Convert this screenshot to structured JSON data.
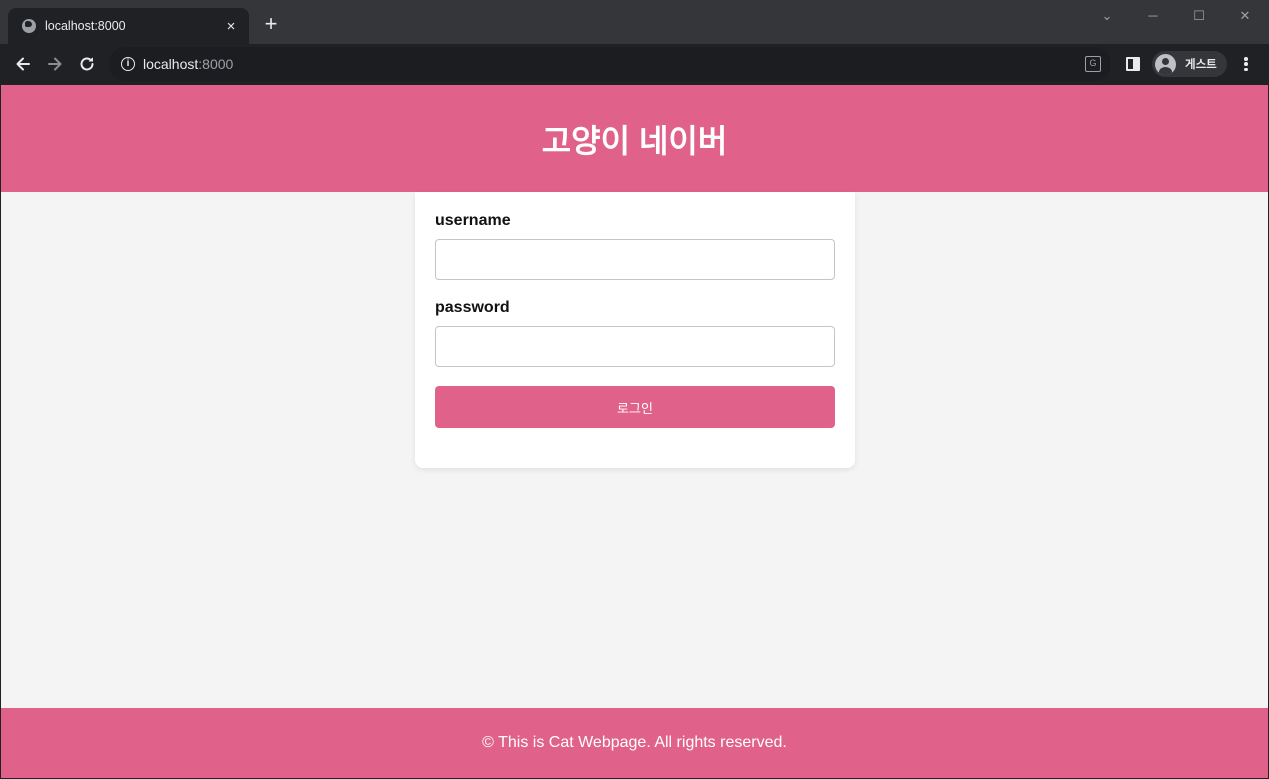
{
  "browser": {
    "tab_title": "localhost:8000",
    "tab_close": "×",
    "new_tab": "+",
    "url_host": "localhost",
    "url_port": ":8000",
    "profile_name": "게스트",
    "window_controls": {
      "minimize": "─",
      "maximize": "☐",
      "close": "✕",
      "tab_search": "⌄"
    }
  },
  "page": {
    "header_title": "고양이 네이버",
    "form": {
      "username_label": "username",
      "username_value": "",
      "password_label": "password",
      "password_value": "",
      "submit_label": "로그인"
    },
    "footer_text": "© This is Cat Webpage. All rights reserved."
  },
  "colors": {
    "brand": "#e0628a",
    "page_background": "#f4f4f4",
    "card": "#ffffff",
    "browser_frame": "#202124",
    "tab_strip": "#35363a"
  },
  "icons": [
    "globe-icon",
    "close-icon",
    "plus-icon",
    "back-arrow-icon",
    "forward-arrow-icon",
    "reload-icon",
    "info-icon",
    "translate-icon",
    "side-panel-icon",
    "avatar-icon",
    "kebab-menu-icon"
  ]
}
